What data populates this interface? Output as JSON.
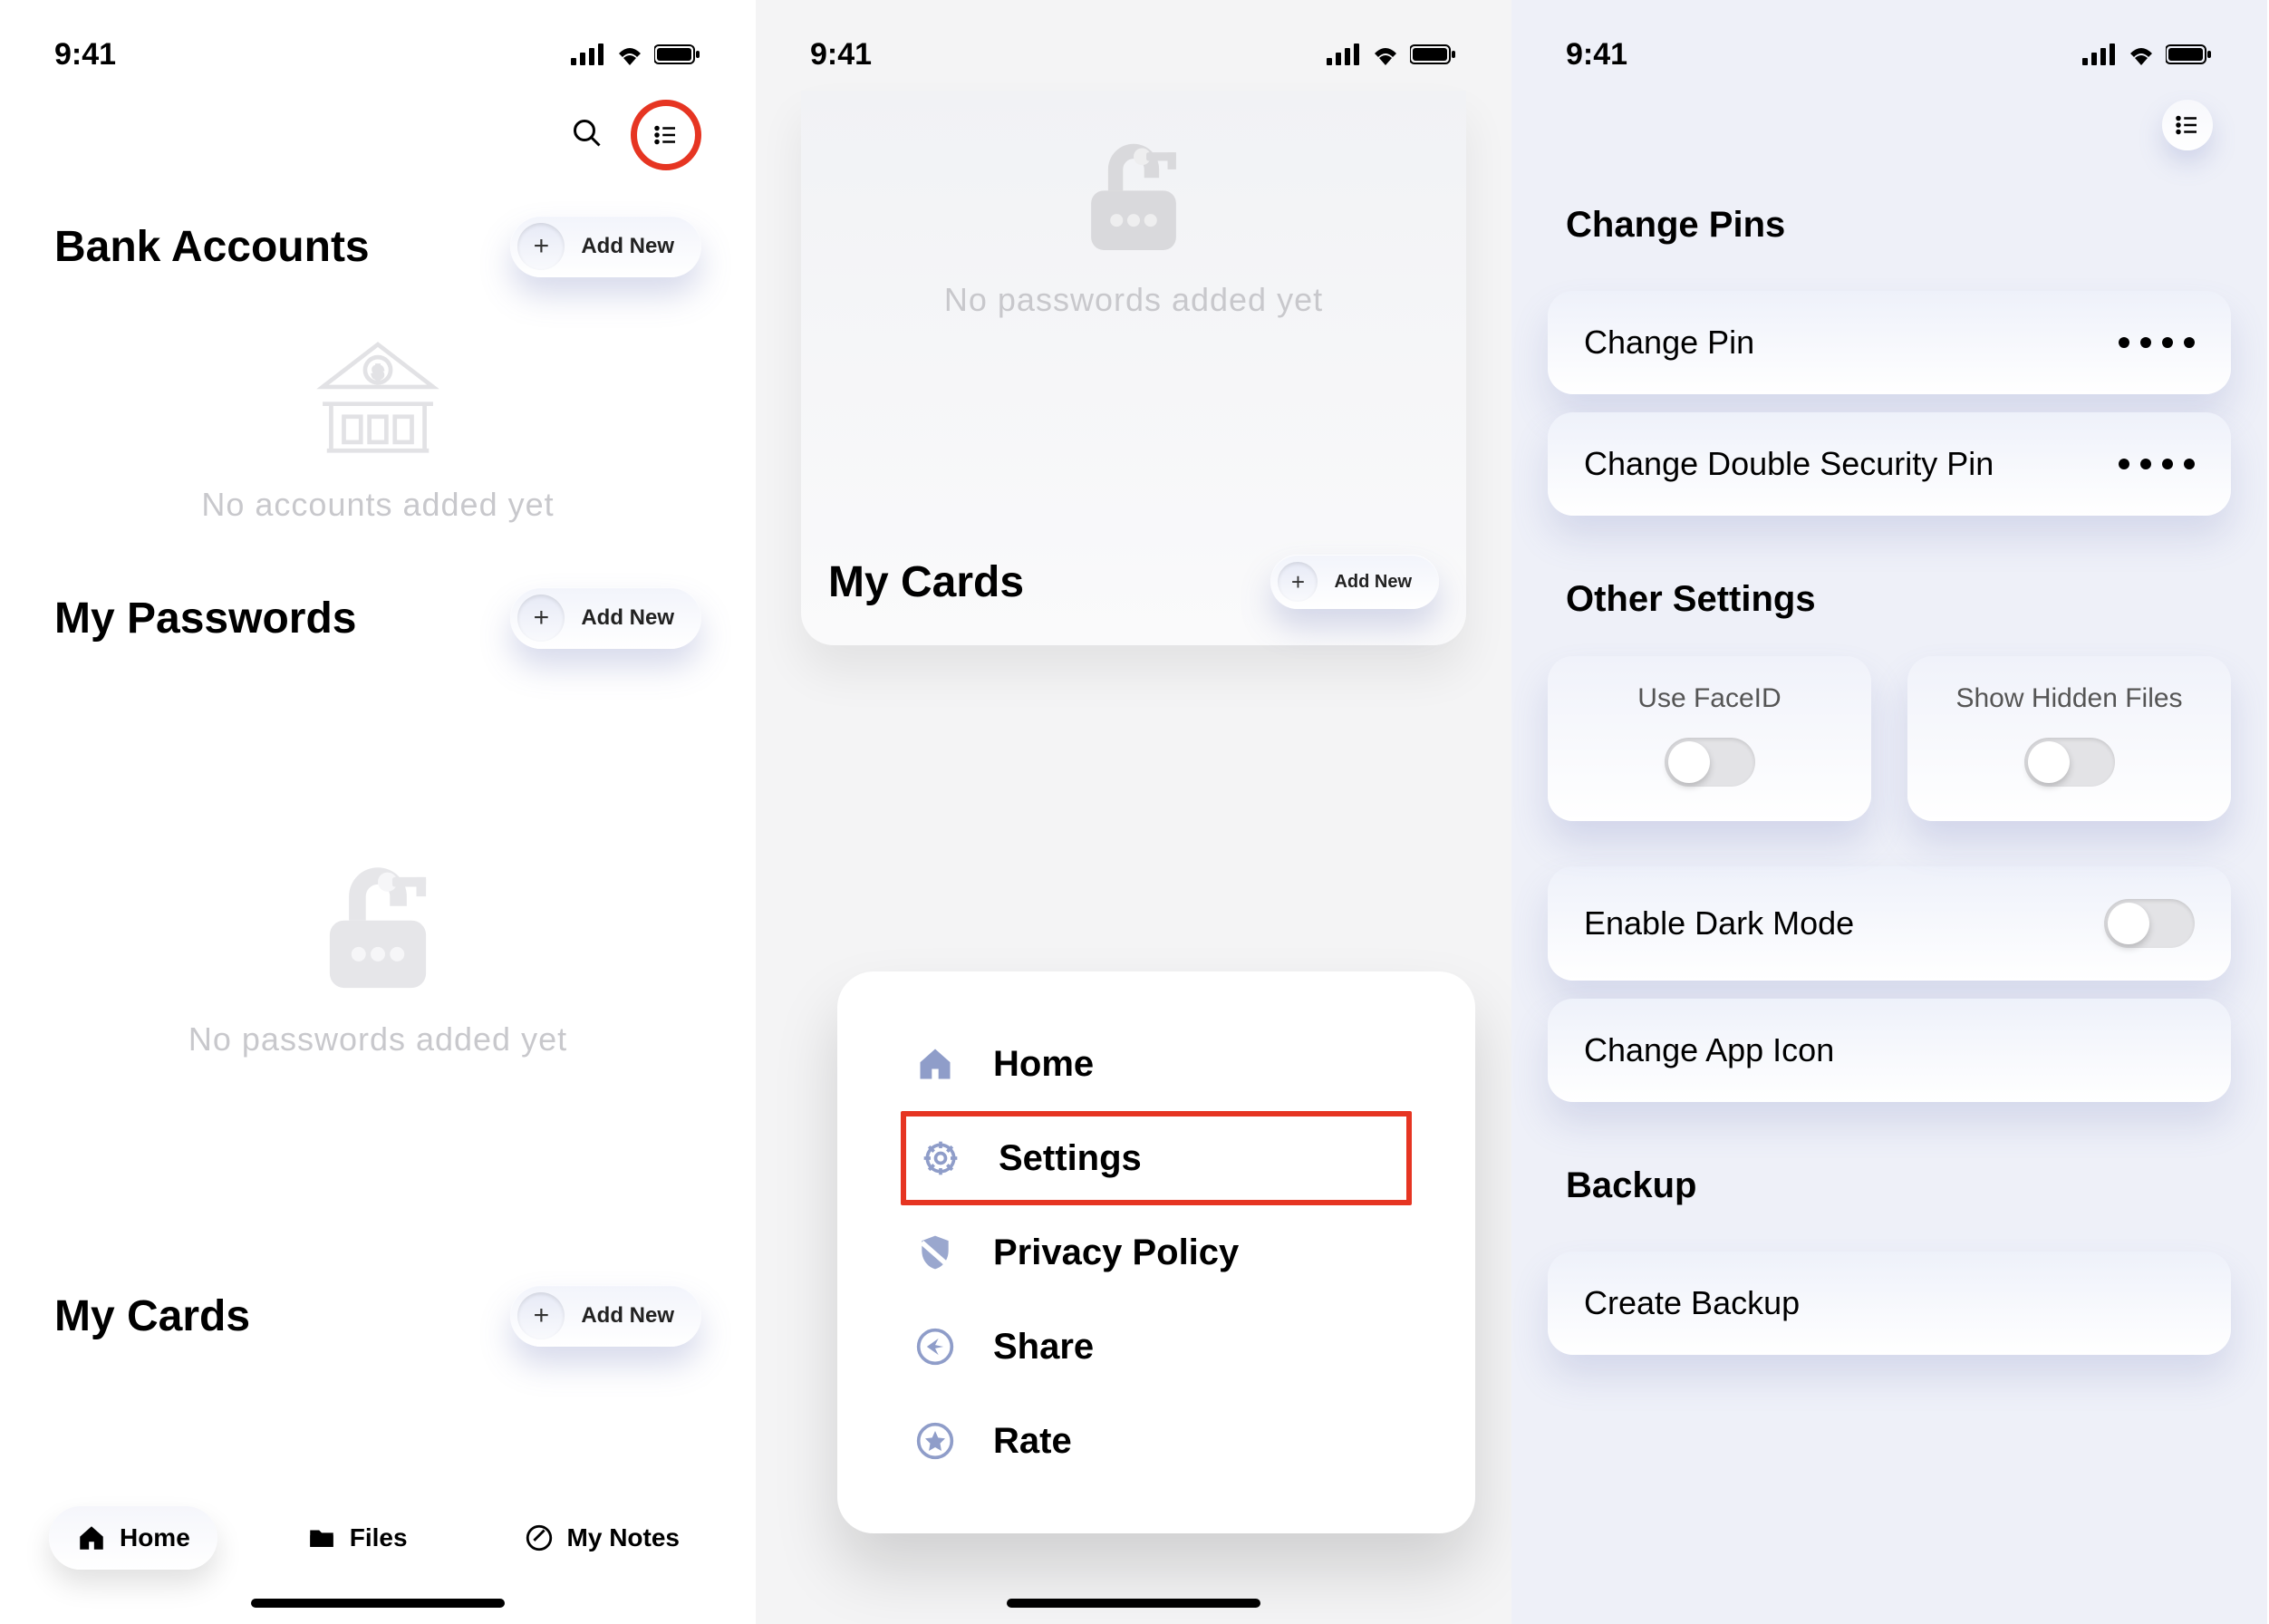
{
  "statusbar": {
    "time": "9:41"
  },
  "p1": {
    "sections": {
      "bank": {
        "title": "Bank Accounts",
        "add": "Add New",
        "empty": "No accounts added yet"
      },
      "passwords": {
        "title": "My Passwords",
        "add": "Add New",
        "empty": "No passwords added yet"
      },
      "cards": {
        "title": "My Cards",
        "add": "Add New"
      }
    },
    "tabs": {
      "home": "Home",
      "files": "Files",
      "notes": "My Notes"
    }
  },
  "p2": {
    "empty_passwords": "No passwords added yet",
    "cards": {
      "title": "My Cards",
      "add": "Add New"
    },
    "menu": {
      "home": "Home",
      "settings": "Settings",
      "privacy": "Privacy Policy",
      "share": "Share",
      "rate": "Rate"
    }
  },
  "p3": {
    "section_pins": "Change Pins",
    "change_pin": "Change Pin",
    "change_double_pin": "Change Double Security Pin",
    "section_other": "Other Settings",
    "use_faceid": "Use FaceID",
    "show_hidden": "Show Hidden Files",
    "dark_mode": "Enable Dark Mode",
    "app_icon": "Change App Icon",
    "section_backup": "Backup",
    "create_backup": "Create Backup"
  }
}
